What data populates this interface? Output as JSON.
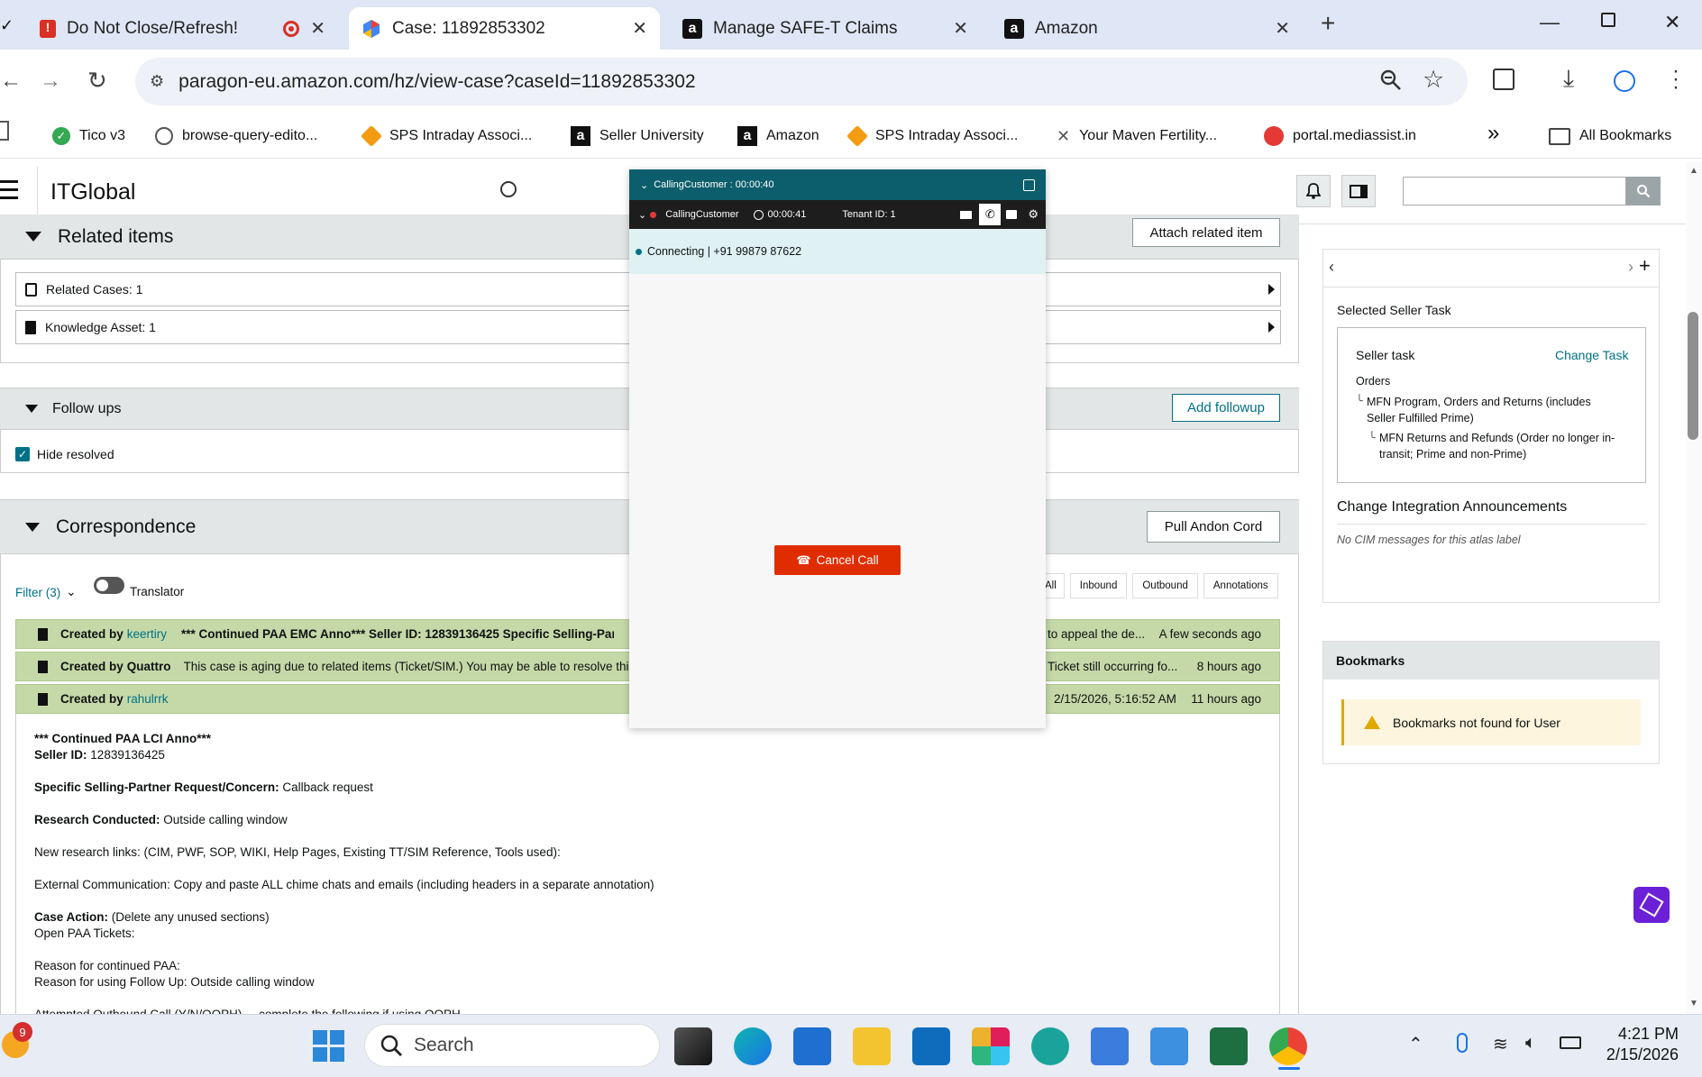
{
  "tabs": [
    {
      "title": "Do Not Close/Refresh!",
      "icon": "alert-icon"
    },
    {
      "title": "Case: 11892853302",
      "icon": "paragon-icon"
    },
    {
      "title": "Manage SAFE-T Claims",
      "icon": "amazon-icon"
    },
    {
      "title": "Amazon",
      "icon": "amazon-icon"
    }
  ],
  "url": "paragon-eu.amazon.com/hz/view-case?caseId=11892853302",
  "bookmarks": [
    "Tico v3",
    "browse-query-edito...",
    "SPS Intraday Associ...",
    "Seller University",
    "Amazon",
    "SPS Intraday Associ...",
    "Your Maven Fertility...",
    "portal.mediassist.in"
  ],
  "all_bookmarks": "All Bookmarks",
  "overflow": "»",
  "app": {
    "title": "ITGlobal"
  },
  "related": {
    "title": "Related items",
    "attach_label": "Attach related item",
    "rows": [
      "Related Cases: 1",
      "Knowledge Asset: 1"
    ]
  },
  "followups": {
    "title": "Follow ups",
    "add_label": "Add followup",
    "hide_resolved": "Hide resolved"
  },
  "correspondence": {
    "title": "Correspondence",
    "andon_label": "Pull Andon Cord",
    "filter_label": "Filter (3)",
    "translator_label": "Translator",
    "filters": [
      "All",
      "Inbound",
      "Outbound",
      "Annotations"
    ],
    "rows": [
      {
        "prefix": "Created by",
        "user": "keertiry",
        "snippet": "*** Continued PAA EMC Anno*** Seller ID: 12839136425 Specific Selling-Partner Re",
        "tail": "to appeal the de...",
        "time": "A few seconds ago"
      },
      {
        "prefix": "Created by",
        "user": "Quattro",
        "snippet": "This case is aging due to related items (Ticket/SIM.) You may be able to resolve this c",
        "tail": "Ticket still occurring fo...",
        "time": "8 hours ago"
      },
      {
        "prefix": "Created by",
        "user": "rahulrrk",
        "snippet": "",
        "tail": "2/15/2026, 5:16:52 AM",
        "time": "11 hours ago"
      }
    ],
    "body": {
      "l1": "*** Continued PAA LCI Anno***",
      "seller_label": "Seller ID:",
      "seller_id": "12839136425",
      "req_label": "Specific Selling-Partner Request/Concern:",
      "req_val": "Callback request",
      "res_label": "Research Conducted:",
      "res_val": "Outside calling window",
      "links": "New research links: (CIM, PWF, SOP, WIKI, Help Pages, Existing TT/SIM Reference, Tools used):",
      "ext": "External Communication: Copy and paste ALL chime chats and emails (including headers in a separate annotation)",
      "action_label": "Case Action:",
      "action_val": "(Delete any unused sections)",
      "open": "Open PAA Tickets:",
      "reason1": "Reason for continued PAA:",
      "reason2": "Reason for using Follow Up: Outside calling window",
      "cut": "Attempted Outbound Call (Y/N/OOPH) ... complete the following if using OOPH"
    }
  },
  "call": {
    "header": "CallingCustomer : 00:00:40",
    "status": "CallingCustomer",
    "timer": "00:00:41",
    "tenant": "Tenant ID: 1",
    "connecting": "Connecting | +91 99879 87622",
    "cancel": "Cancel Call"
  },
  "seller_task": {
    "title": "Selected Seller Task",
    "label": "Seller task",
    "change": "Change Task",
    "l1": "Orders",
    "l2": "MFN Program, Orders and Returns (includes Seller Fulfilled Prime)",
    "l3": "MFN Returns and Refunds (Order no longer in-transit; Prime and non-Prime)"
  },
  "cim": {
    "title": "Change Integration Announcements",
    "empty": "No CIM messages for this atlas label"
  },
  "bookmarks_panel": {
    "title": "Bookmarks",
    "empty": "Bookmarks not found for User"
  },
  "taskbar": {
    "search": "Search",
    "time": "4:21 PM",
    "date": "2/15/2026",
    "badge": "9"
  }
}
